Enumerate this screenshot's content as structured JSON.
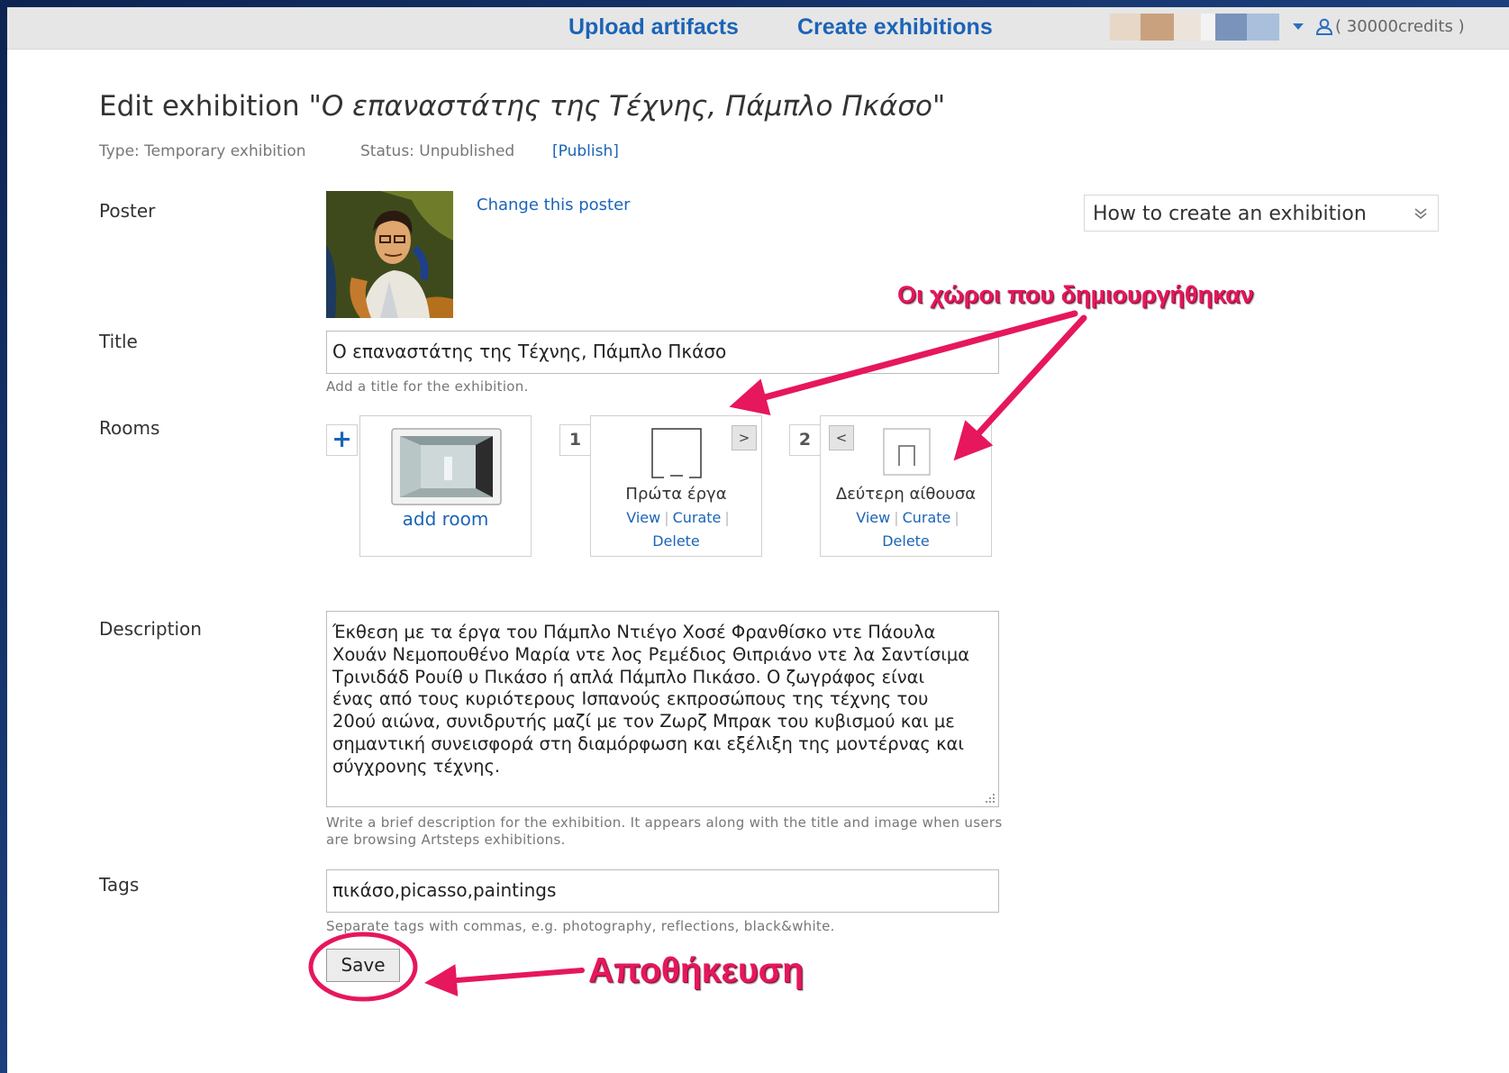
{
  "header": {
    "upload_label": "Upload artifacts",
    "create_label": "Create exhibitions",
    "credits": "( 30000credits )"
  },
  "page": {
    "title_prefix": "Edit exhibition",
    "title_quoted": "\"Ο επαναστάτης της Τέχνης, Πάμπλο Πκάσο\"",
    "type": "Type: Temporary exhibition",
    "status": "Status: Unpublished",
    "publish_link": "[Publish]"
  },
  "form": {
    "poster_label": "Poster",
    "change_poster": "Change this poster",
    "title_label": "Title",
    "title_value": "Ο επαναστάτης της Τέχνης, Πάμπλο Πκάσο",
    "title_hint": "Add a title for the exhibition.",
    "rooms_label": "Rooms",
    "description_label": "Description",
    "description_value": "Έκθεση με τα έργα του Πάμπλο Ντιέγο Χοσέ Φρανθίσκο ντε Πάουλα\nΧουάν Νεμοπουθένο Μαρία ντε λος Ρεμέδιος Θιπριάνο ντε λα Σαντίσιμα\nΤρινιδάδ Ρουίθ υ Πικάσο ή απλά Πάμπλο Πικάσο. Ο ζωγράφος είναι\nένας από τους κυριότερους Ισπανούς εκπροσώπους της τέχνης του\n20ού αιώνα, συνιδρυτής μαζί με τον Ζωρζ Μπρακ του κυβισμού και με\nσημαντική συνεισφορά στη διαμόρφωση και εξέλιξη της μοντέρνας και\nσύγχρονης τέχνης.",
    "description_hint": "Write a brief description for the exhibition. It appears along with the title and image when users are browsing Artsteps exhibitions.",
    "tags_label": "Tags",
    "tags_value": "πικάσο,picasso,paintings",
    "tags_hint": "Separate tags with commas, e.g. photography, reflections, black&white.",
    "save_label": "Save"
  },
  "howto": {
    "label": "How to create an exhibition"
  },
  "rooms": {
    "add_room_label": "add room",
    "plus": "+",
    "items": [
      {
        "number": "1",
        "nav": ">",
        "name": "Πρώτα έργα",
        "view": "View",
        "curate": "Curate",
        "delete": "Delete"
      },
      {
        "number": "2",
        "nav": "<",
        "name": "Δεύτερη αίθουσα",
        "view": "View",
        "curate": "Curate",
        "delete": "Delete"
      }
    ]
  },
  "annotations": {
    "rooms_created": "Οι χώροι που δημιουργήθηκαν",
    "save": "Αποθήκευση"
  },
  "colors": {
    "link": "#1b64b7",
    "annotation": "#e6175c",
    "frame_background": "#1a3a72"
  }
}
